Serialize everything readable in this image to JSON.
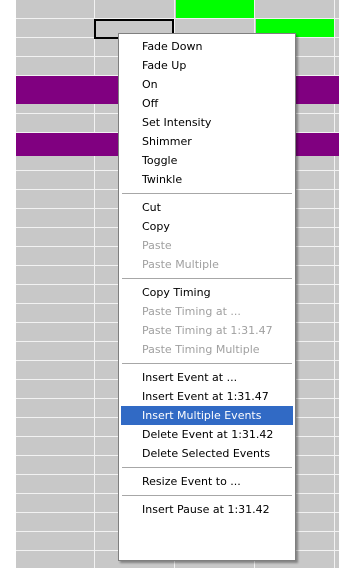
{
  "menu": {
    "groups": [
      [
        {
          "label": "Fade Down",
          "enabled": true
        },
        {
          "label": "Fade Up",
          "enabled": true
        },
        {
          "label": "On",
          "enabled": true
        },
        {
          "label": "Off",
          "enabled": true
        },
        {
          "label": "Set Intensity",
          "enabled": true
        },
        {
          "label": "Shimmer",
          "enabled": true
        },
        {
          "label": "Toggle",
          "enabled": true
        },
        {
          "label": "Twinkle",
          "enabled": true
        }
      ],
      [
        {
          "label": "Cut",
          "enabled": true
        },
        {
          "label": "Copy",
          "enabled": true
        },
        {
          "label": "Paste",
          "enabled": false
        },
        {
          "label": "Paste Multiple",
          "enabled": false
        }
      ],
      [
        {
          "label": "Copy Timing",
          "enabled": true
        },
        {
          "label": "Paste Timing at ...",
          "enabled": false
        },
        {
          "label": "Paste Timing at 1:31.47",
          "enabled": false
        },
        {
          "label": "Paste Timing Multiple",
          "enabled": false
        }
      ],
      [
        {
          "label": "Insert Event at ...",
          "enabled": true
        },
        {
          "label": "Insert Event at 1:31.47",
          "enabled": true
        },
        {
          "label": "Insert Multiple Events",
          "enabled": true,
          "highlighted": true
        },
        {
          "label": "Delete Event at 1:31.42",
          "enabled": true
        },
        {
          "label": "Delete Selected Events",
          "enabled": true
        }
      ],
      [
        {
          "label": "Resize Event to ...",
          "enabled": true
        }
      ],
      [
        {
          "label": "Insert Pause at 1:31.42",
          "enabled": true
        }
      ]
    ]
  },
  "colors": {
    "grid_bg": "#c8c8c8",
    "grid_line": "#f2f2f2",
    "event_green": "#00ff00",
    "event_purple": "#800080",
    "highlight": "#316ac5",
    "disabled_text": "#a0a0a0"
  }
}
